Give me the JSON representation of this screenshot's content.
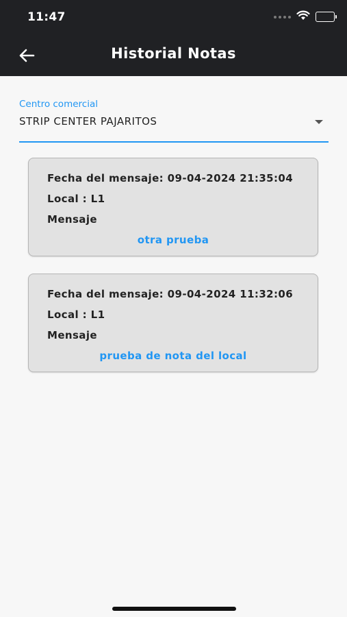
{
  "status_bar": {
    "time": "11:47"
  },
  "header": {
    "title": "Historial Notas"
  },
  "filter": {
    "label": "Centro comercial",
    "value": "STRIP CENTER PAJARITOS"
  },
  "notes": [
    {
      "date_label": "Fecha del mensaje:",
      "date": "09-04-2024 21:35:04",
      "local_label": "Local :",
      "local": "L1",
      "message_label": "Mensaje",
      "message": "otra prueba"
    },
    {
      "date_label": "Fecha del mensaje:",
      "date": "09-04-2024 11:32:06",
      "local_label": "Local :",
      "local": "L1",
      "message_label": "Mensaje",
      "message": "prueba de nota del local"
    }
  ],
  "colors": {
    "app_bar": "#202124",
    "accent": "#2196f3",
    "card": "#e2e2e2"
  }
}
